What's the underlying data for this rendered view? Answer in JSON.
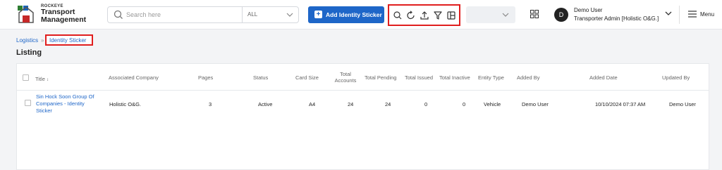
{
  "brand": {
    "small": "ROCKEYE",
    "line1": "Transport",
    "line2": "Management"
  },
  "search": {
    "placeholder": "Search here",
    "filter_value": "ALL"
  },
  "add_button": {
    "label": "Add Identity Sticker",
    "plus": "+"
  },
  "toolbar_icons": [
    "search-icon",
    "refresh-icon",
    "upload-icon",
    "filter-icon",
    "columns-icon"
  ],
  "user": {
    "initial": "D",
    "name": "Demo User",
    "role": "Transporter Admin [Holistic O&G.]"
  },
  "menu": {
    "label": "Menu"
  },
  "breadcrumb": {
    "parent": "Logistics",
    "separator": "»",
    "current": "Identity Sticker"
  },
  "page": {
    "title": "Listing"
  },
  "table": {
    "headers": {
      "title": "Title",
      "sort": "↕",
      "company": "Associated Company",
      "pages": "Pages",
      "status": "Status",
      "card_size": "Card Size",
      "total_accounts_1": "Total",
      "total_accounts_2": "Accounts",
      "total_pending": "Total Pending",
      "total_issued": "Total Issued",
      "total_inactive": "Total Inactive",
      "entity_type": "Entity Type",
      "added_by": "Added By",
      "added_date": "Added Date",
      "updated_by": "Updated By"
    },
    "rows": [
      {
        "title_1": "Sin Hock Soon Group Of",
        "title_2": "Companies - Identity",
        "title_3": "Sticker",
        "company": "Holistic O&G.",
        "pages": "3",
        "status": "Active",
        "card_size": "A4",
        "total_accounts": "24",
        "total_pending": "24",
        "total_issued": "0",
        "total_inactive": "0",
        "entity_type": "Vehicle",
        "added_by": "Demo User",
        "added_date": "10/10/2024 07:37 AM",
        "updated_by": "Demo User"
      }
    ]
  }
}
